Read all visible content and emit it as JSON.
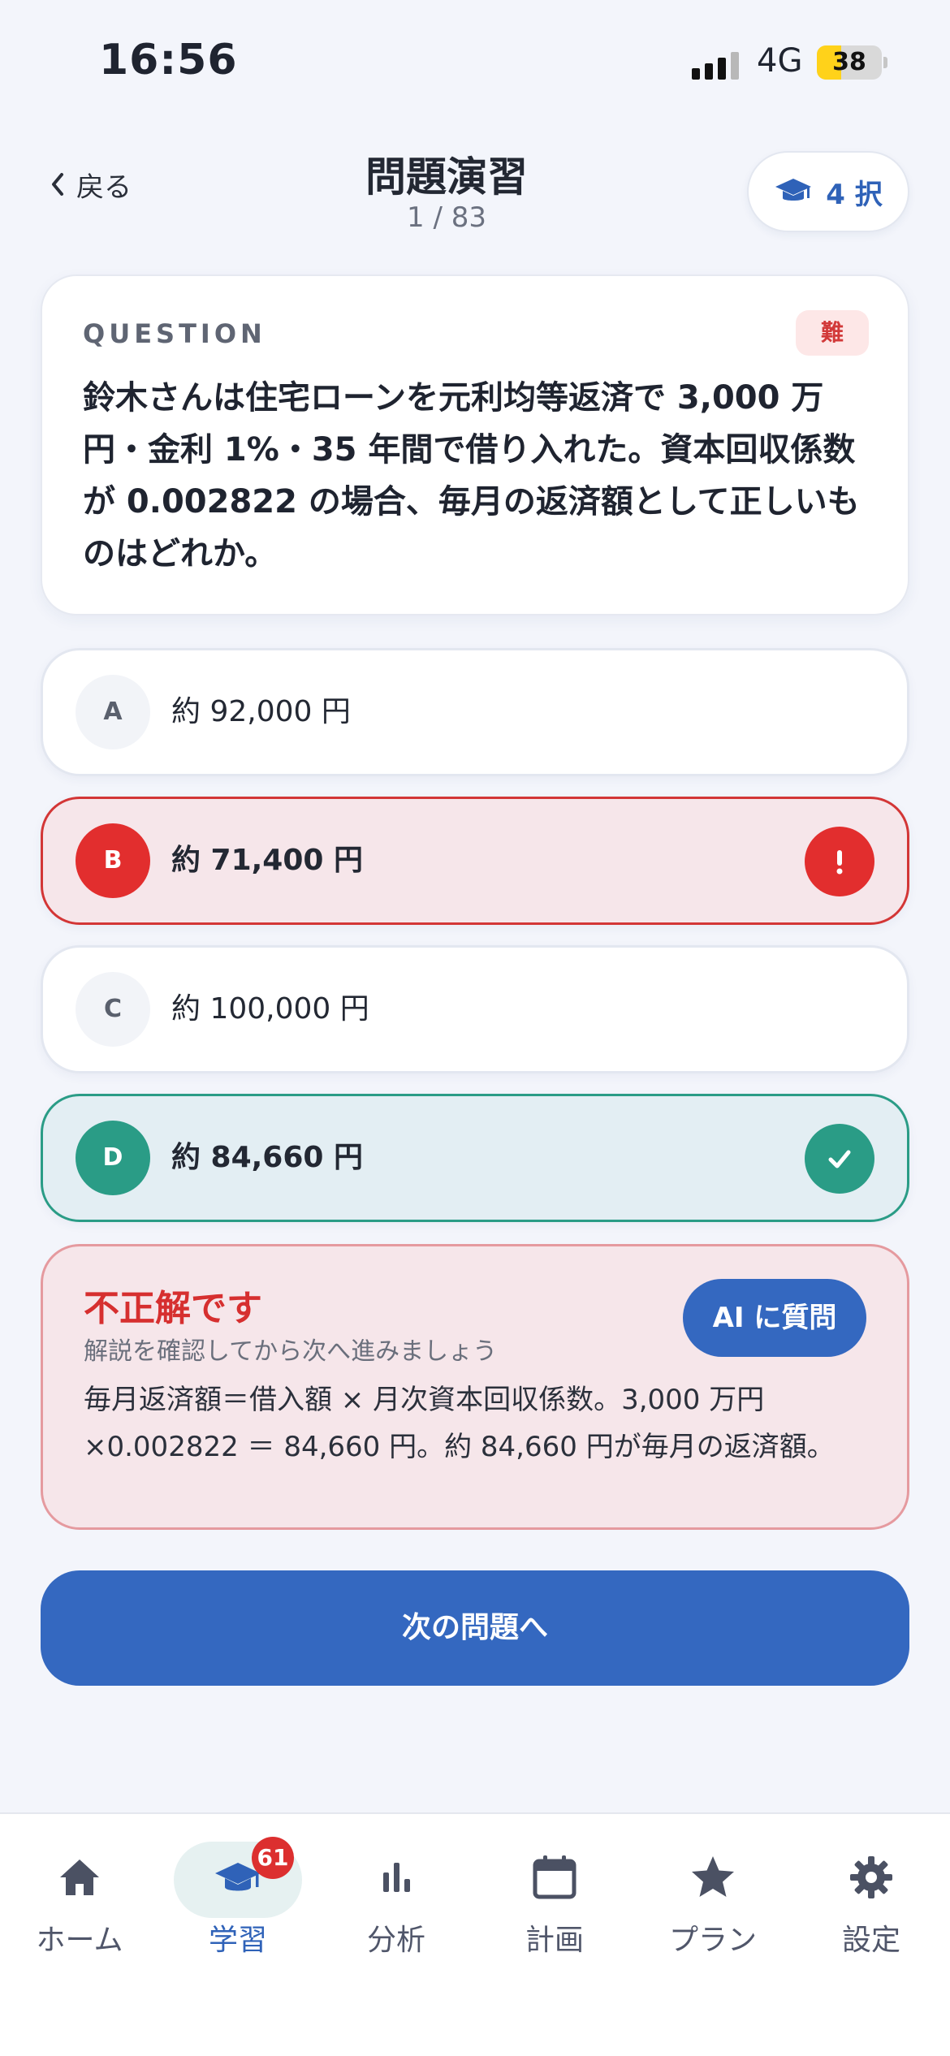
{
  "status_bar": {
    "time": "16:56",
    "network": "4G",
    "battery": "38",
    "battery_level": 0.38,
    "signal_bars_on": 3,
    "signal_bars_total": 4
  },
  "header": {
    "back_label": "戻る",
    "title": "問題演習",
    "progress": "1 / 83",
    "mode_label": "4 択"
  },
  "question": {
    "label": "QUESTION",
    "difficulty": "難",
    "text": "鈴木さんは住宅ローンを元利均等返済で 3,000 万円・金利 1%・35 年間で借り入れた。資本回収係数が 0.002822 の場合、毎月の返済額として正しいものはどれか。"
  },
  "options": [
    {
      "letter": "A",
      "text": "約 92,000 円",
      "state": "default"
    },
    {
      "letter": "B",
      "text": "約 71,400 円",
      "state": "wrong",
      "status_icon": "alert-icon"
    },
    {
      "letter": "C",
      "text": "約 100,000 円",
      "state": "default"
    },
    {
      "letter": "D",
      "text": "約 84,660 円",
      "state": "correct",
      "status_icon": "check-icon"
    }
  ],
  "feedback": {
    "title": "不正解です",
    "subtitle": "解説を確認してから次へ進みましょう",
    "ask_ai_label": "AI に質問",
    "explanation": "毎月返済額＝借入額 × 月次資本回収係数。3,000 万円 ×0.002822 ＝ 84,660 円。約 84,660 円が毎月の返済額。"
  },
  "next_button_label": "次の問題へ",
  "bottom_nav": {
    "items": [
      {
        "label": "ホーム",
        "icon": "home-icon"
      },
      {
        "label": "学習",
        "icon": "graduation-cap-icon",
        "active": true,
        "badge": "61"
      },
      {
        "label": "分析",
        "icon": "bar-chart-icon"
      },
      {
        "label": "計画",
        "icon": "calendar-icon"
      },
      {
        "label": "プラン",
        "icon": "star-icon"
      },
      {
        "label": "設定",
        "icon": "gear-icon"
      }
    ]
  },
  "colors": {
    "accent": "#3468c0",
    "wrong": "#e22e2e",
    "correct": "#2a9c86",
    "background": "#f3f5fb"
  }
}
